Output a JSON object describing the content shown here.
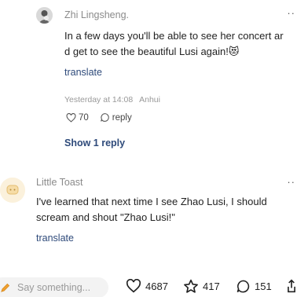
{
  "reply": {
    "username": "Zhi Lingsheng.",
    "text": "In a few days you'll be able to see her concert ar\nd get to see the beautiful Lusi again!😻",
    "translate": "translate",
    "time": "Yesterday at 14:08",
    "location": "Anhui",
    "likes": "70",
    "reply_label": "reply",
    "more": "··"
  },
  "show_replies": "Show 1 reply",
  "comment": {
    "username": "Little Toast",
    "text": "I've learned that next time I see Zhao Lusi, I should\nscream and shout \"Zhao Lusi!\"",
    "translate": "translate",
    "more": "··"
  },
  "bottom_bar": {
    "placeholder": "Say something...",
    "likes": "4687",
    "favorites": "417",
    "comments": "151"
  },
  "colors": {
    "link": "#2e4a7a",
    "muted": "#999999"
  }
}
